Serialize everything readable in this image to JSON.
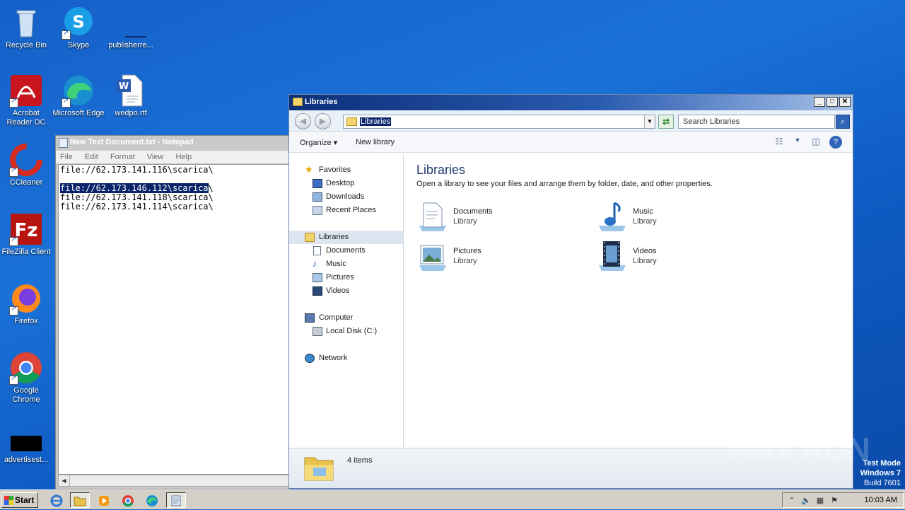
{
  "desktop": {
    "icons": [
      {
        "label": "Recycle Bin"
      },
      {
        "label": "Skype"
      },
      {
        "label": "publisherre..."
      },
      {
        "label": "Acrobat Reader DC"
      },
      {
        "label": "Microsoft Edge"
      },
      {
        "label": "wedpo.rtf"
      },
      {
        "label": "CCleaner"
      },
      {
        "label": "FileZilla Client"
      },
      {
        "label": "Firefox"
      },
      {
        "label": "Google Chrome"
      },
      {
        "label": "advertisest..."
      }
    ]
  },
  "notepad": {
    "title": "New Text Document.txt - Notepad",
    "menu": [
      "File",
      "Edit",
      "Format",
      "View",
      "Help"
    ],
    "lines": [
      "file://62.173.141.116\\scarica\\",
      "",
      "file://62.173.146.112\\scarica\\",
      "file://62.173.141.118\\scarica\\",
      "file://62.173.141.114\\scarica\\"
    ],
    "selected_text": "file://62.173.146.112\\scarica",
    "selected_rest": "\\"
  },
  "explorer": {
    "title": "Libraries",
    "window_buttons": {
      "minimize": "_",
      "maximize": "□",
      "close": "✕"
    },
    "address": "Libraries",
    "search_placeholder": "Search Libraries",
    "toolbar": {
      "organize": "Organize ▾",
      "new_library": "New library"
    },
    "nav": {
      "favorites": "Favorites",
      "desktop": "Desktop",
      "downloads": "Downloads",
      "recent_places": "Recent Places",
      "libraries": "Libraries",
      "documents": "Documents",
      "music": "Music",
      "pictures": "Pictures",
      "videos": "Videos",
      "computer": "Computer",
      "local_disk": "Local Disk (C:)",
      "network": "Network"
    },
    "content": {
      "heading": "Libraries",
      "subtitle": "Open a library to see your files and arrange them by folder, date, and other properties.",
      "libraries": [
        {
          "name": "Documents",
          "type": "Library"
        },
        {
          "name": "Music",
          "type": "Library"
        },
        {
          "name": "Pictures",
          "type": "Library"
        },
        {
          "name": "Videos",
          "type": "Library"
        }
      ]
    },
    "status": "4 items"
  },
  "taskbar": {
    "start_label": "Start",
    "clock": "10:03 AM"
  },
  "overlay": {
    "watermark": "ANY RUN",
    "test_mode": "Test Mode",
    "os": "Windows 7",
    "build": "Build 7601"
  }
}
